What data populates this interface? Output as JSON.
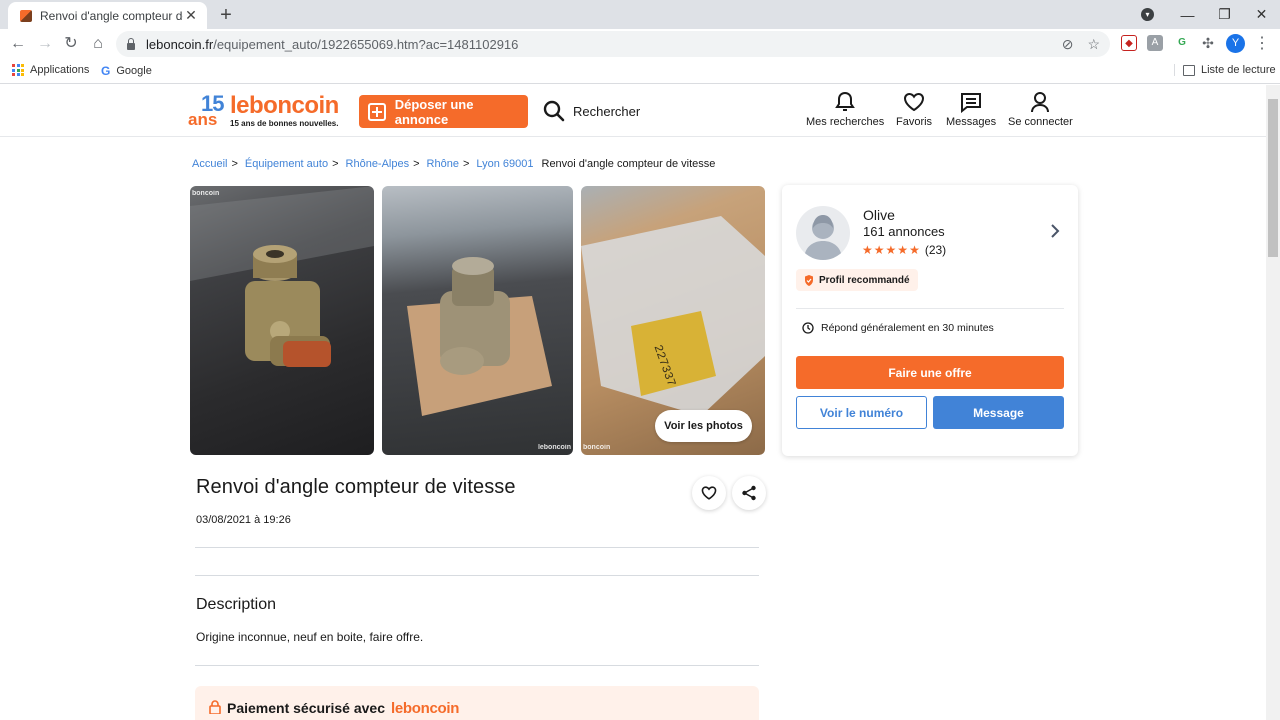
{
  "browser": {
    "tab_title": "Renvoi d'angle compteur de vitesse",
    "url_host": "leboncoin.fr",
    "url_path": "/equipement_auto/1922655069.htm?ac=1481102916",
    "bookmarks": [
      "Applications",
      "Google"
    ],
    "reading_list": "Liste de lecture",
    "profile_initial": "Y"
  },
  "header": {
    "logo_15": "15",
    "logo_ans": "ans",
    "logo_name": "leboncoin",
    "logo_tagline": "15 ans de bonnes nouvelles.",
    "post_button": "Déposer une annonce",
    "search_label": "Rechercher",
    "nav": [
      "Mes recherches",
      "Favoris",
      "Messages",
      "Se connecter"
    ]
  },
  "breadcrumb": {
    "items": [
      "Accueil",
      "Équipement auto",
      "Rhône-Alpes",
      "Rhône",
      "Lyon 69001"
    ],
    "current": "Renvoi d'angle compteur de vitesse"
  },
  "gallery": {
    "watermark": "boncoin",
    "watermark_full": "leboncoin",
    "see_photos": "Voir les photos"
  },
  "listing": {
    "title": "Renvoi d'angle compteur de vitesse",
    "date": "03/08/2021 à 19:26",
    "description_heading": "Description",
    "description": "Origine inconnue, neuf en boite, faire offre.",
    "secure_payment": "Paiement sécurisé avec",
    "secure_payment_brand": "leboncoin"
  },
  "seller": {
    "name": "Olive",
    "ads_count": "161 annonces",
    "rating": 5,
    "reviews": "(23)",
    "badge": "Profil recommandé",
    "response": "Répond généralement en 30 minutes",
    "offer_button": "Faire une offre",
    "number_button": "Voir le numéro",
    "message_button": "Message"
  },
  "colors": {
    "brand_orange": "#f56b2a",
    "brand_blue": "#4183d7"
  }
}
